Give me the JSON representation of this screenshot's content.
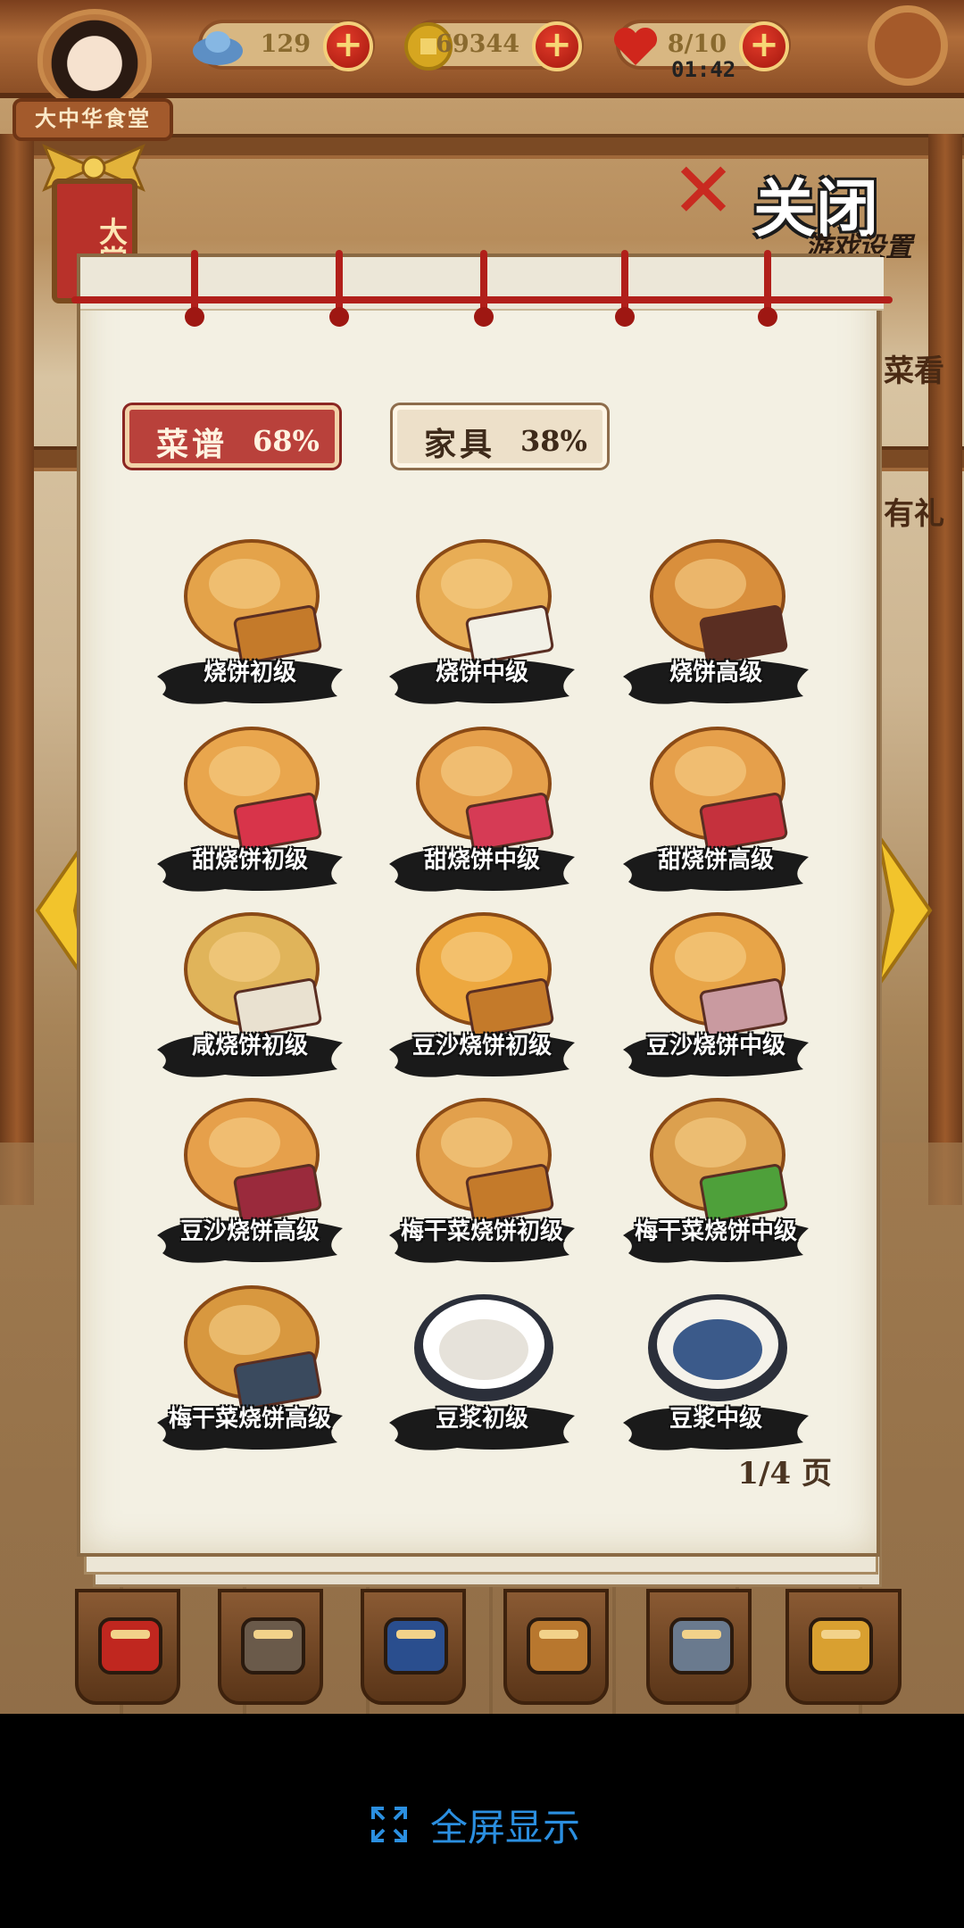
{
  "header": {
    "resources": [
      {
        "name": "silver-ingot",
        "value": "129"
      },
      {
        "name": "gold-coin",
        "value": "69344"
      },
      {
        "name": "heart",
        "value": "8/10"
      }
    ],
    "timer": "01:42",
    "restaurant_name": "大中华食堂",
    "side_tag": "大赏"
  },
  "close_label": "关闭",
  "settings_label": "游戏设置",
  "side_peek": [
    "菜看",
    "有礼"
  ],
  "tabs": [
    {
      "label": "菜谱",
      "percent": "68%"
    },
    {
      "label": "家具",
      "percent": "38%"
    }
  ],
  "items": [
    {
      "label": "烧饼初级"
    },
    {
      "label": "烧饼中级"
    },
    {
      "label": "烧饼高级"
    },
    {
      "label": "甜烧饼初级"
    },
    {
      "label": "甜烧饼中级"
    },
    {
      "label": "甜烧饼高级"
    },
    {
      "label": "咸烧饼初级"
    },
    {
      "label": "豆沙烧饼初级"
    },
    {
      "label": "豆沙烧饼中级"
    },
    {
      "label": "豆沙烧饼高级"
    },
    {
      "label": "梅干菜烧饼初级"
    },
    {
      "label": "梅干菜烧饼中级"
    },
    {
      "label": "梅干菜烧饼高级"
    },
    {
      "label": "豆浆初级"
    },
    {
      "label": "豆浆中级"
    }
  ],
  "page_indicator": "1/4 页",
  "toolbar": [
    "food-box-icon",
    "hammer-icon",
    "recipe-book-icon",
    "pot-icon",
    "chef-icon",
    "wok-icon"
  ],
  "system": {
    "fullscreen_label": "全屏显示"
  }
}
